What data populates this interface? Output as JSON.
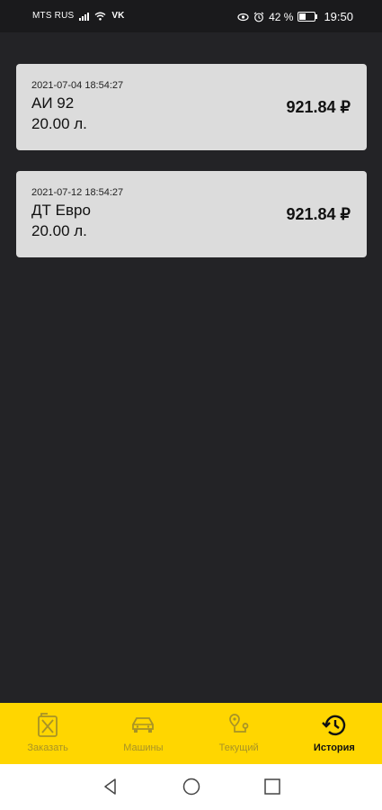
{
  "status_bar": {
    "carrier": "MTS RUS",
    "vk": "VK",
    "battery_percent": "42 %",
    "battery_level": 0.42,
    "time": "19:50"
  },
  "history": [
    {
      "datetime": "2021-07-04 18:54:27",
      "fuel": "АИ 92",
      "volume": "20.00 л.",
      "price": "921.84 ₽"
    },
    {
      "datetime": "2021-07-12 18:54:27",
      "fuel": "ДТ Евро",
      "volume": "20.00 л.",
      "price": "921.84 ₽"
    }
  ],
  "nav": {
    "items": [
      {
        "label": "Заказать",
        "icon": "fuel-can-icon",
        "active": false
      },
      {
        "label": "Машины",
        "icon": "car-icon",
        "active": false
      },
      {
        "label": "Текущий",
        "icon": "route-icon",
        "active": false
      },
      {
        "label": "История",
        "icon": "history-icon",
        "active": true
      }
    ]
  },
  "colors": {
    "background": "#232326",
    "card": "#dcdcdc",
    "nav_bg": "#ffd600",
    "nav_inactive": "#a89326",
    "nav_active": "#111111"
  }
}
